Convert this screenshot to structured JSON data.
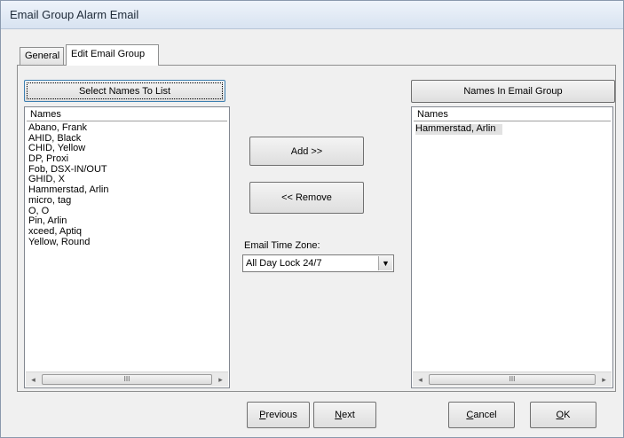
{
  "window": {
    "title": "Email Group Alarm Email"
  },
  "tabs": [
    {
      "label": "General"
    },
    {
      "label": "Edit Email Group"
    }
  ],
  "left_panel": {
    "header_button": "Select Names To List",
    "list_column": "Names",
    "items": [
      "Abano, Frank",
      "AHID, Black",
      "CHID, Yellow",
      "DP, Proxi",
      "Fob, DSX-IN/OUT",
      "GHID, X",
      "Hammerstad, Arlin",
      "micro, tag",
      "O, O",
      "Pin, Arlin",
      "xceed, Aptiq",
      "Yellow, Round"
    ]
  },
  "middle": {
    "add_button": "Add >>",
    "remove_button": "<< Remove",
    "time_zone_label": "Email Time Zone:",
    "time_zone_value": "All Day Lock 24/7"
  },
  "right_panel": {
    "header_button": "Names In Email Group",
    "list_column": "Names",
    "items": [
      "Hammerstad, Arlin"
    ]
  },
  "footer": {
    "previous": {
      "mnemonic": "P",
      "rest": "revious"
    },
    "next": {
      "mnemonic": "N",
      "rest": "ext"
    },
    "cancel": {
      "mnemonic": "C",
      "rest": "ancel"
    },
    "ok": {
      "mnemonic": "O",
      "rest": "K"
    }
  },
  "scrollbar": {
    "left_arrow_icon": "◂",
    "right_arrow_icon": "▸",
    "thumb_grip": "III"
  },
  "icons": {
    "dropdown_arrow": "▼"
  }
}
